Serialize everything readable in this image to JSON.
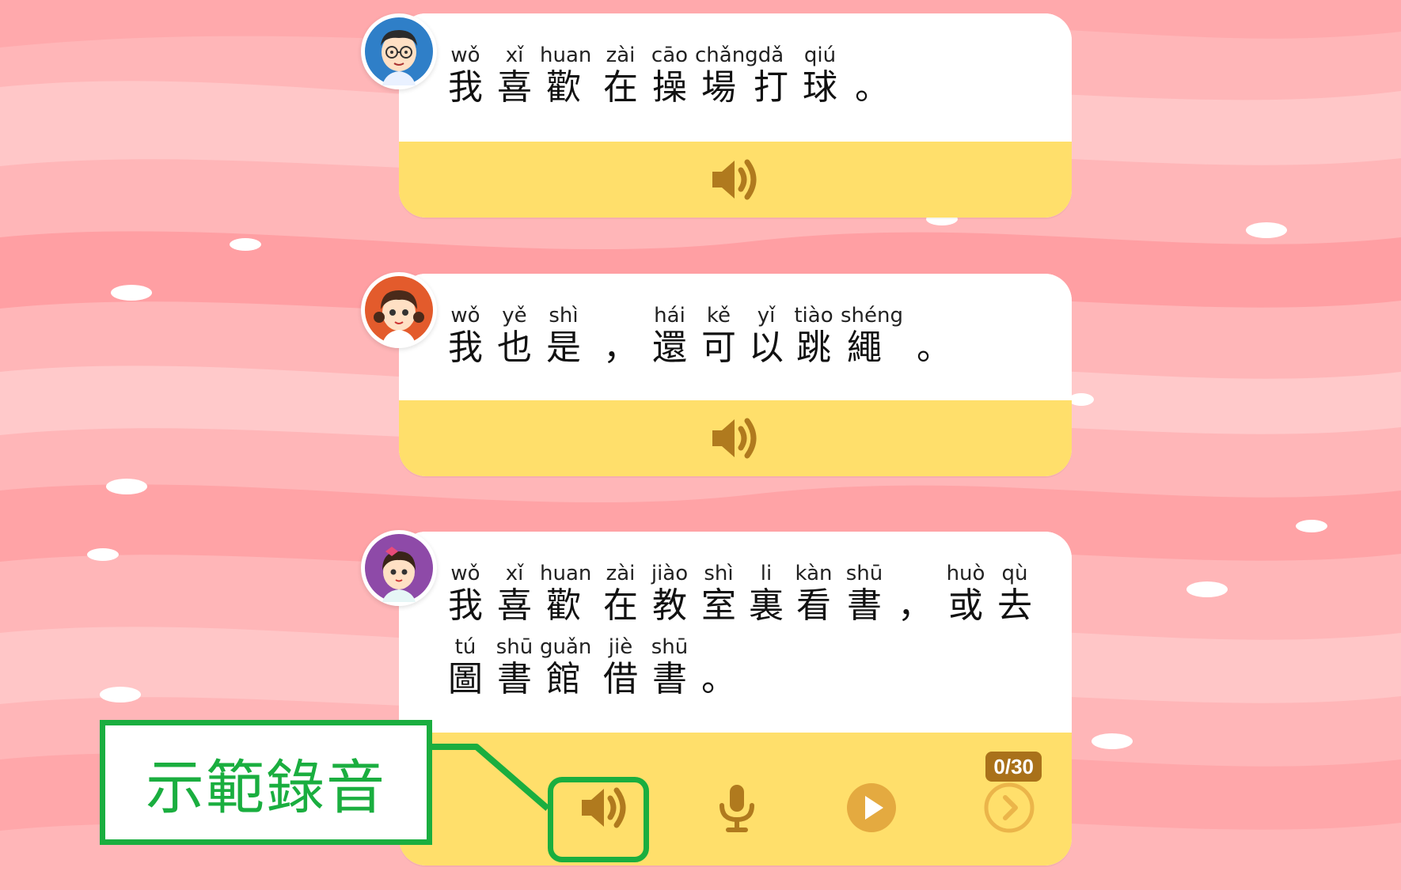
{
  "colors": {
    "card_bar": "#ffdf6b",
    "icon_brown": "#b07a1e",
    "callout_green": "#1aae3f",
    "background_pink": "#ffb3b5"
  },
  "dialogs": [
    {
      "speaker": "boy-with-glasses",
      "lines": [
        [
          {
            "py": "wǒ",
            "hz": "我"
          },
          {
            "py": "xǐ",
            "hz": "喜"
          },
          {
            "py": "huan",
            "hz": "歡"
          },
          {
            "py": "zài",
            "hz": "在"
          },
          {
            "py": "cāo",
            "hz": "操"
          },
          {
            "py": "chǎng",
            "hz": "場"
          },
          {
            "py": "dǎ",
            "hz": "打"
          },
          {
            "py": "qiú",
            "hz": "球"
          },
          {
            "py": "",
            "hz": "。"
          }
        ]
      ],
      "audio_icon": "speaker-icon"
    },
    {
      "speaker": "girl-with-pigtails",
      "lines": [
        [
          {
            "py": "wǒ",
            "hz": "我"
          },
          {
            "py": "yě",
            "hz": "也"
          },
          {
            "py": "shì",
            "hz": "是"
          },
          {
            "py": "",
            "hz": "，"
          },
          {
            "py": "hái",
            "hz": "還"
          },
          {
            "py": "kě",
            "hz": "可"
          },
          {
            "py": "yǐ",
            "hz": "以"
          },
          {
            "py": "tiào",
            "hz": "跳"
          },
          {
            "py": "shéng",
            "hz": "繩"
          },
          {
            "py": "",
            "hz": "。"
          }
        ]
      ],
      "audio_icon": "speaker-icon"
    },
    {
      "speaker": "girl-with-bow",
      "lines": [
        [
          {
            "py": "wǒ",
            "hz": "我"
          },
          {
            "py": "xǐ",
            "hz": "喜"
          },
          {
            "py": "huan",
            "hz": "歡"
          },
          {
            "py": "zài",
            "hz": "在"
          },
          {
            "py": "jiào",
            "hz": "教"
          },
          {
            "py": "shì",
            "hz": "室"
          },
          {
            "py": "li",
            "hz": "裏"
          },
          {
            "py": "kàn",
            "hz": "看"
          },
          {
            "py": "shū",
            "hz": "書"
          },
          {
            "py": "",
            "hz": "，"
          },
          {
            "py": "huò",
            "hz": "或"
          },
          {
            "py": "qù",
            "hz": "去"
          }
        ],
        [
          {
            "py": "tú",
            "hz": "圖"
          },
          {
            "py": "shū",
            "hz": "書"
          },
          {
            "py": "guǎn",
            "hz": "館"
          },
          {
            "py": "jiè",
            "hz": "借"
          },
          {
            "py": "shū",
            "hz": "書"
          },
          {
            "py": "",
            "hz": "。"
          }
        ]
      ],
      "counter": "0/30",
      "controls": [
        "speaker-icon",
        "microphone-icon",
        "play-icon",
        "next-icon"
      ]
    }
  ],
  "callout": {
    "label": "示範錄音"
  }
}
